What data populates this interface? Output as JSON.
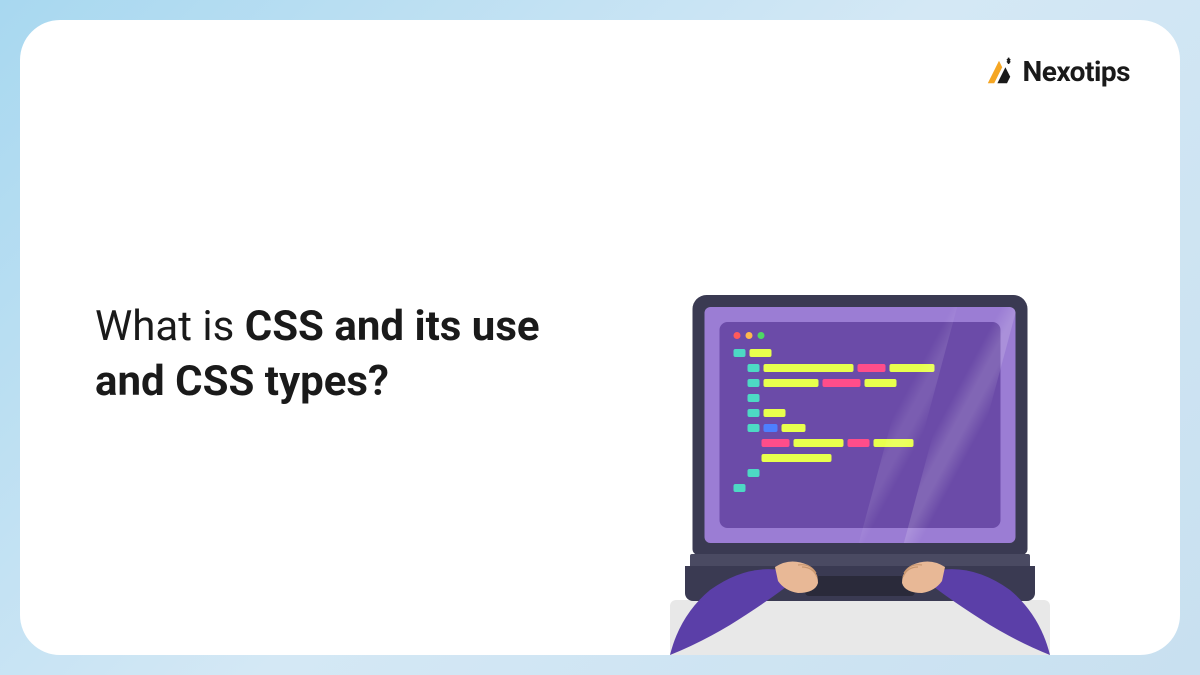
{
  "logo": {
    "text": "Nexotips"
  },
  "headline": {
    "part1": "What is ",
    "part2_bold": "CSS and its use and CSS types?"
  },
  "colors": {
    "accent_orange": "#f5a623",
    "code_teal": "#4dd9c4",
    "code_yellow": "#e8ff4d",
    "code_pink": "#ff4d8a",
    "code_blue": "#4d7fff"
  }
}
